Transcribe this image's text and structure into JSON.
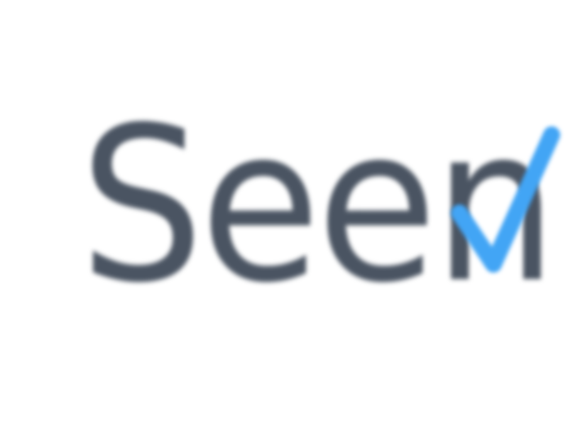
{
  "status": {
    "label": "Seen",
    "icon": "check-icon",
    "label_color": "#4a5462",
    "icon_color": "#42a5f5"
  }
}
